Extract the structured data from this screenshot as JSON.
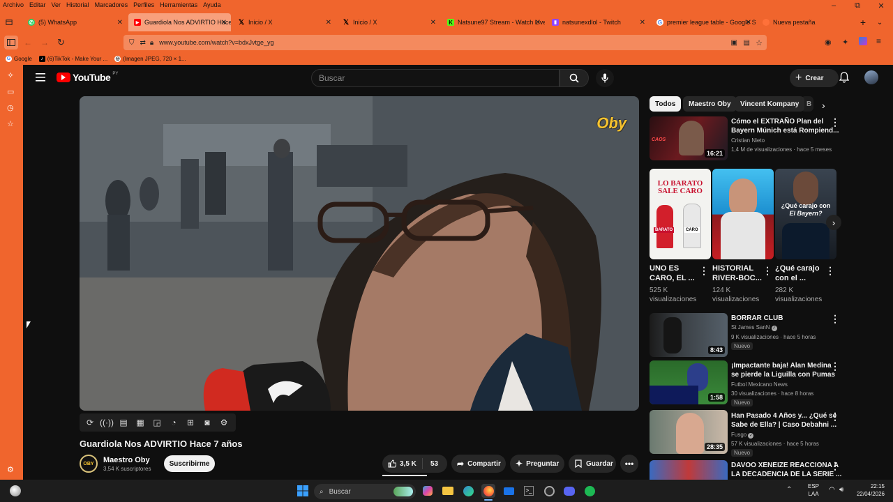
{
  "menubar": [
    "Archivo",
    "Editar",
    "Ver",
    "Historial",
    "Marcadores",
    "Perfiles",
    "Herramientas",
    "Ayuda"
  ],
  "tabs": [
    {
      "label": "(5) WhatsApp",
      "icon": "whatsapp-icon",
      "color": "#25d366"
    },
    {
      "label": "Guardiola Nos ADVIRTIO Hace",
      "icon": "youtube-icon",
      "color": "#ff0000"
    },
    {
      "label": "Inicio / X",
      "icon": "x-icon",
      "color": "#000000"
    },
    {
      "label": "Inicio / X",
      "icon": "x-icon",
      "color": "#000000"
    },
    {
      "label": "Natsune97 Stream - Watch Live",
      "icon": "kick-icon",
      "color": "#53fc18"
    },
    {
      "label": "natsunexdlol - Twitch",
      "icon": "twitch-icon",
      "color": "#9146ff"
    },
    {
      "label": "premier league table - Google S",
      "icon": "google-icon",
      "color": "#4285f4"
    },
    {
      "label": "Nueva pestaña",
      "icon": "firefox-icon",
      "color": "#ff7139"
    }
  ],
  "url": "www.youtube.com/watch?v=bdxJvtge_yg",
  "bookmarks": [
    "Google",
    "(6)TikTok - Make Your ...",
    "(Imagen JPEG, 720 × 1..."
  ],
  "yt": {
    "logo": "YouTube",
    "logo_country": "PY",
    "search_placeholder": "Buscar",
    "create_label": "Crear",
    "video_title": "Guardiola Nos ADVIRTIO Hace 7 años",
    "watermark": "Oby",
    "channel": "Maestro Oby",
    "channel_avatar": "OBY",
    "subs": "3,54 K suscriptores",
    "subscribe": "Suscribirme",
    "likes": "3,5 K",
    "dislikes": "53",
    "share": "Compartir",
    "ask": "Preguntar",
    "save": "Guardar",
    "chips": [
      "Todos",
      "Maestro Oby",
      "Vincent Kompany",
      "B"
    ],
    "rec_top": {
      "title1": "Cómo el EXTRAÑO Plan del",
      "title2": "Bayern Múnich está Rompiend...",
      "channel": "Cristian Nieto",
      "meta": "1,4 M de visualizaciones · hace 5 meses",
      "duration": "16:21"
    },
    "shorts": [
      {
        "title1": "UNO ES",
        "title2": "CARO, EL ...",
        "views1": "525 K",
        "views2": "visualizaciones",
        "thumb_text1": "LO BARATO",
        "thumb_text2": "SALE CARO",
        "tag1": "BARATO",
        "tag2": "CARO"
      },
      {
        "title1": "HISTORIAL",
        "title2": "RIVER-BOC...",
        "views1": "124 K",
        "views2": "visualizaciones"
      },
      {
        "title1": "¿Qué carajo",
        "title2": "con el ...",
        "views1": "282 K",
        "views2": "visualizaciones",
        "thumb_text1": "¿Qué carajo con",
        "thumb_text2": "El Bayern?"
      }
    ],
    "recs": [
      {
        "title1": "BORRAR CLUB",
        "title2": "",
        "channel": "St James SanN",
        "meta": "9 K visualizaciones · hace 5 horas",
        "badge": "Nuevo",
        "duration": "8:43"
      },
      {
        "title1": "¡Impactante baja! Alan Medina",
        "title2": "se pierde la Liguilla con Pumas",
        "channel": "Futbol Mexicano News",
        "meta": "30 visualizaciones · hace 8 horas",
        "badge": "Nuevo",
        "duration": "1:58"
      },
      {
        "title1": "Han Pasado 4 Años y... ¿Qué se",
        "title2": "Sabe de Ella? | Caso Debahni ...",
        "channel": "Fusgo",
        "meta": "57 K visualizaciones · hace 5 horas",
        "badge": "Nuevo",
        "duration": "28:35"
      },
      {
        "title1": "DAVOO XENEIZE REACCIONA A",
        "title2": "LA DECADENCIA DE LA SERIE ...",
        "channel": "",
        "meta": "",
        "badge": "",
        "duration": ""
      }
    ]
  },
  "taskbar": {
    "search": "Buscar",
    "lang1": "ESP",
    "lang2": "LAA",
    "time": "22:15",
    "date": "22/04/2026"
  }
}
